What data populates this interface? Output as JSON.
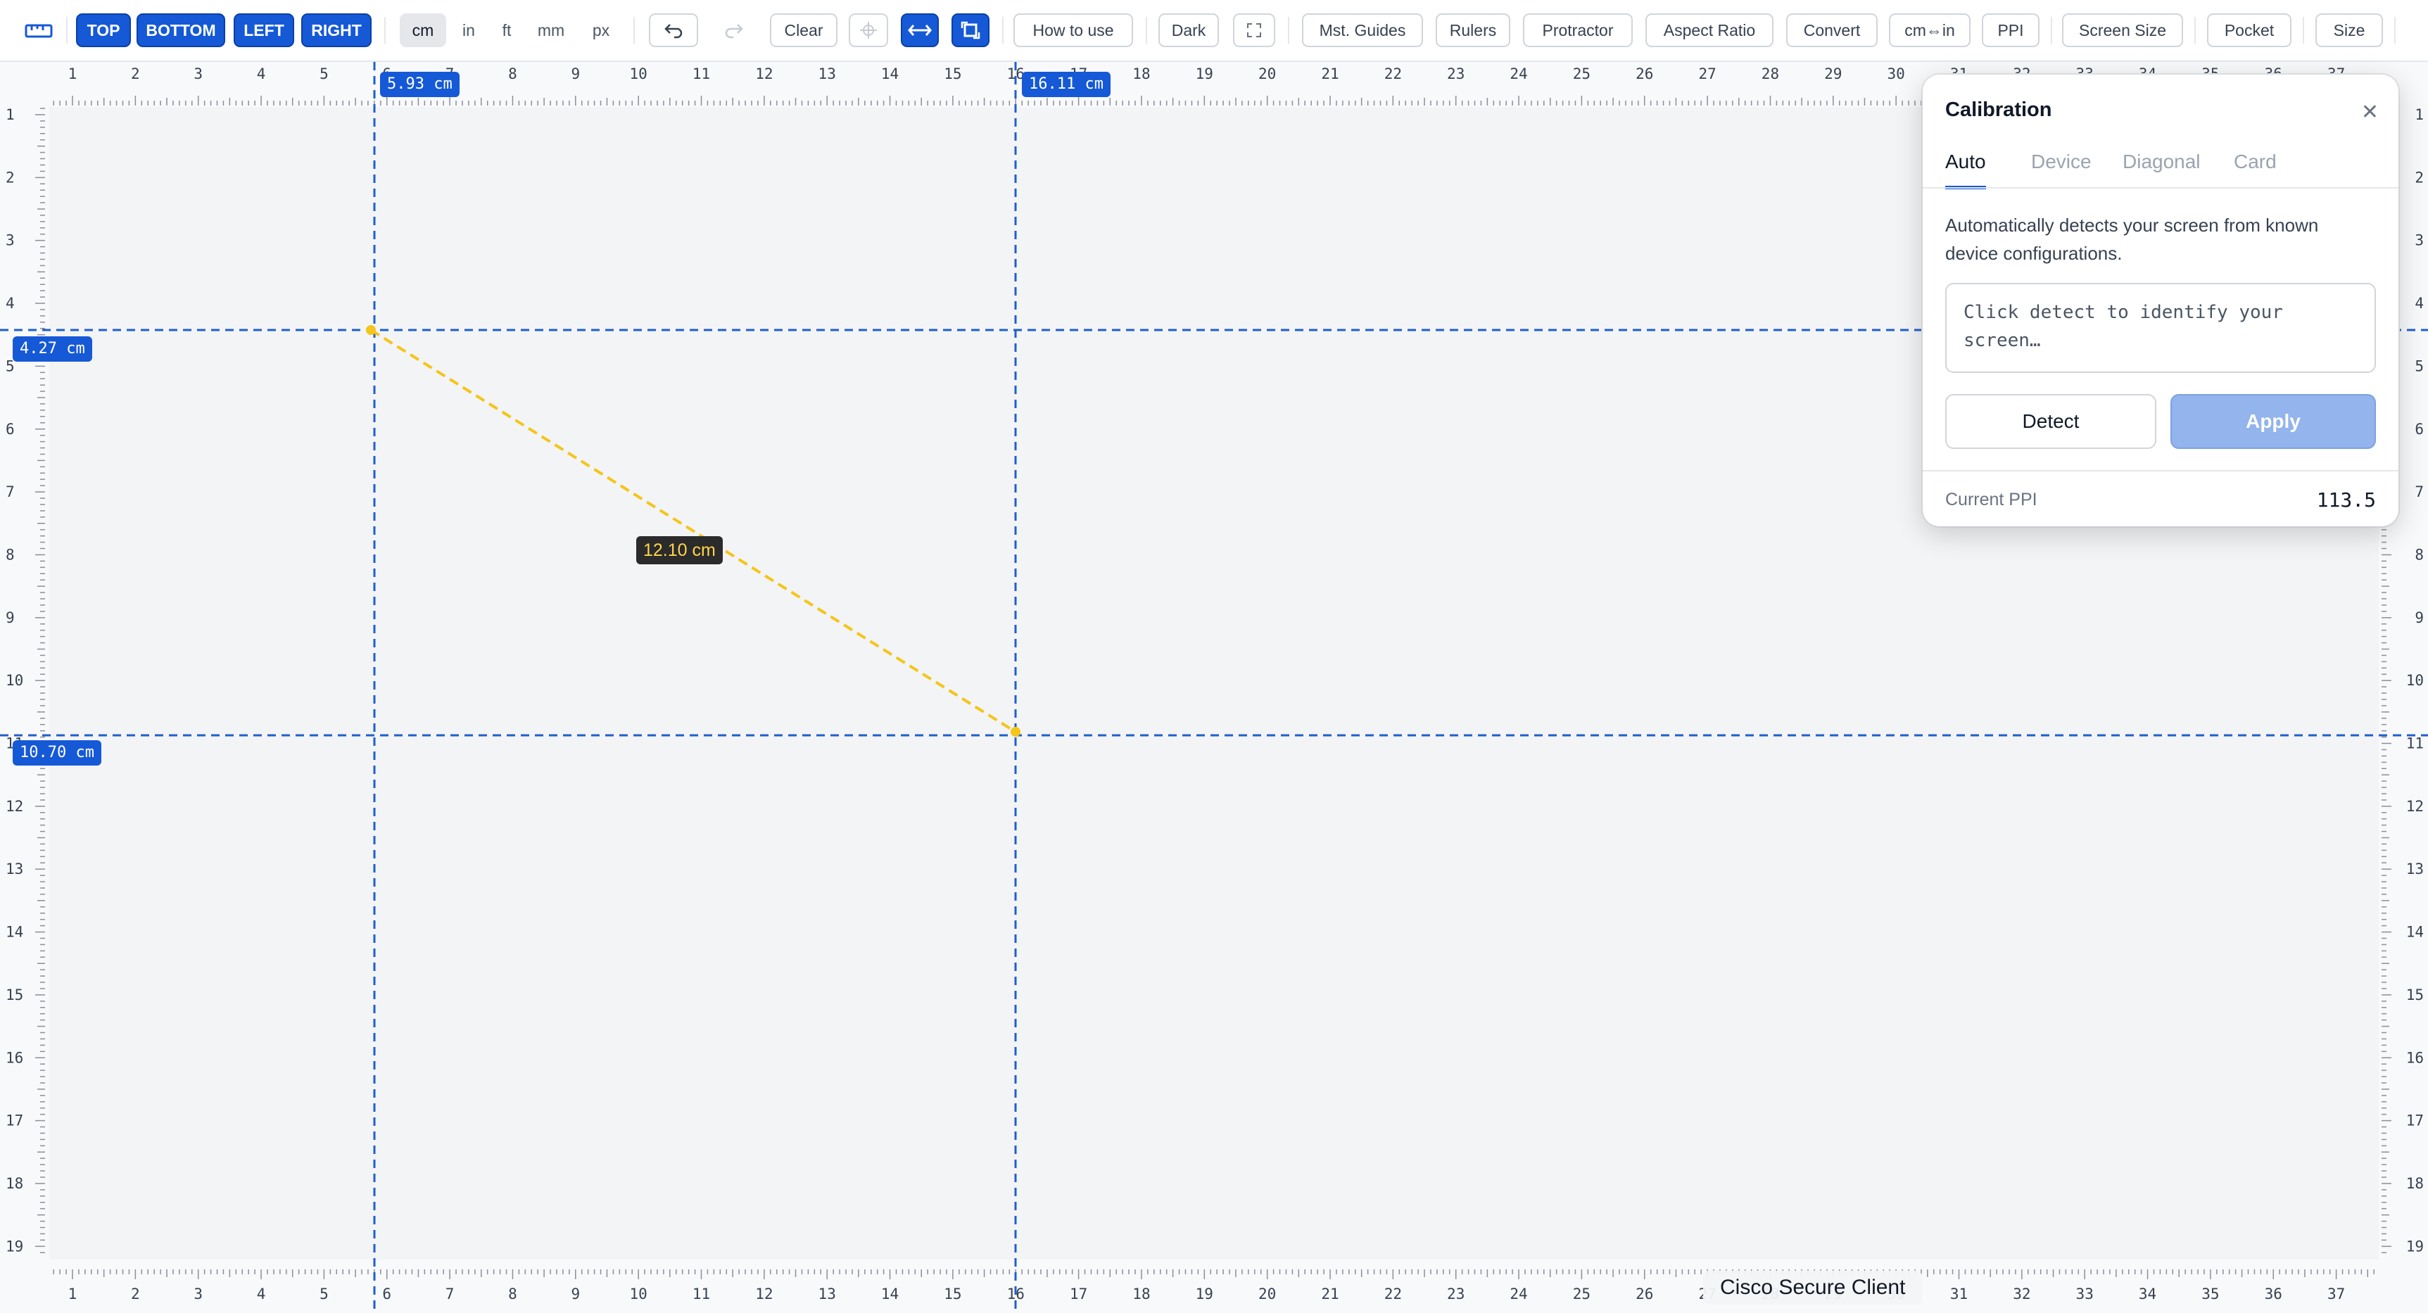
{
  "toolbar": {
    "ruler_icon": "ruler-icon",
    "sides": [
      "TOP",
      "BOTTOM",
      "LEFT",
      "RIGHT"
    ],
    "units": [
      "cm",
      "in",
      "ft",
      "mm",
      "px"
    ],
    "active_unit": "cm",
    "undo_icon": "undo-icon",
    "redo_icon": "redo-icon",
    "clear": "Clear",
    "crosshair_icon": "crosshair-icon",
    "swap_icon": "swap-horizontal-icon",
    "rotate_icon": "rotate-icon",
    "how_to_use": "How to use",
    "dark": "Dark",
    "fullscreen_icon": "fullscreen-icon",
    "mst_guides": "Mst. Guides",
    "rulers": "Rulers",
    "protractor": "Protractor",
    "aspect_ratio": "Aspect Ratio",
    "convert": "Convert",
    "cm_in": "cm⇔in",
    "ppi": "PPI",
    "screen_size": "Screen Size",
    "pocket": "Pocket",
    "size": "Size"
  },
  "rulers": {
    "horizontal_labels": [
      "1",
      "2",
      "3",
      "4",
      "5",
      "6",
      "7",
      "8",
      "9",
      "10",
      "11",
      "12",
      "13",
      "14",
      "15",
      "16",
      "17",
      "18",
      "19",
      "20",
      "21",
      "22",
      "23",
      "24",
      "25",
      "26",
      "27",
      "28",
      "29",
      "30",
      "31",
      "32",
      "33",
      "34",
      "35",
      "36",
      "37"
    ],
    "vertical_labels": [
      "1",
      "2",
      "3",
      "4",
      "5",
      "6",
      "7",
      "8",
      "9",
      "10",
      "11",
      "12",
      "13",
      "14",
      "15",
      "16",
      "17",
      "18",
      "19"
    ]
  },
  "guides": {
    "vertical_1": "5.93 cm",
    "vertical_2": "16.11 cm",
    "horizontal_1": "4.27 cm",
    "horizontal_2": "10.70 cm"
  },
  "measurement": {
    "label": "12.10 cm"
  },
  "calibration": {
    "title": "Calibration",
    "close_icon": "close-icon",
    "tabs": [
      "Auto",
      "Device",
      "Diagonal",
      "Card"
    ],
    "active_tab": "Auto",
    "description": "Automatically detects your screen from known device configurations.",
    "detect_placeholder": "Click detect to identify your screen…",
    "detect_button": "Detect",
    "apply_button": "Apply",
    "ppi_label": "Current PPI",
    "ppi_value": "113.5"
  },
  "tooltip": {
    "text": "Cisco Secure Client"
  },
  "colors": {
    "accent": "#1559d6",
    "guide": "#1f5fd0",
    "measure_line": "#f5c518",
    "measure_text": "#ffd54a",
    "canvas_bg": "#f3f4f6"
  }
}
